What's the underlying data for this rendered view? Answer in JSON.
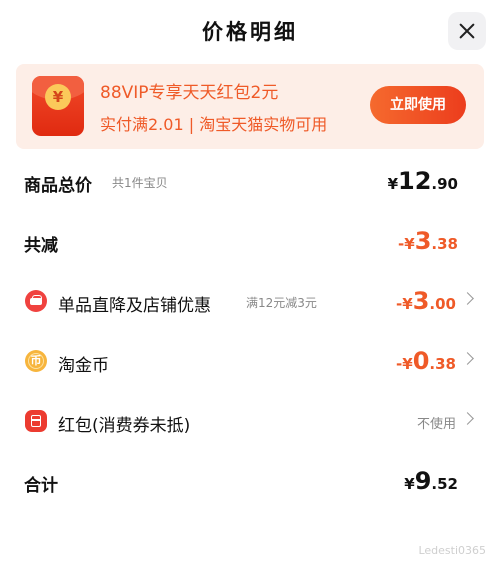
{
  "header": {
    "title": "价格明细"
  },
  "promo": {
    "coin_symbol": "¥",
    "line1": "88VIP专享天天红包2元",
    "line2": "实付满2.01 | 淘宝天猫实物可用",
    "button": "立即使用"
  },
  "rows": {
    "goods_total": {
      "label": "商品总价",
      "sub": "共1件宝贝",
      "currency": "¥",
      "int": "12",
      "dec": ".90"
    },
    "total_reduced": {
      "label": "共减",
      "prefix": "-¥",
      "int": "3",
      "dec": ".38"
    },
    "shop_discount": {
      "label": "单品直降及店铺优惠",
      "sub": "满12元减3元",
      "prefix": "-¥",
      "int": "3",
      "dec": ".00"
    },
    "tao_coin": {
      "label": "淘金币",
      "coin_char": "币",
      "prefix": "-¥",
      "int": "0",
      "dec": ".38"
    },
    "red_packet": {
      "label": "红包(消费券未抵)",
      "value": "不使用"
    },
    "grand_total": {
      "label": "合计",
      "currency": "¥",
      "int": "9",
      "dec": ".52"
    }
  },
  "watermark": "Ledesti0365",
  "colors": {
    "accent": "#ef5a28",
    "promo_bg": "#fdeee7",
    "button_start": "#f56a2e",
    "button_end": "#ec3d1d"
  }
}
